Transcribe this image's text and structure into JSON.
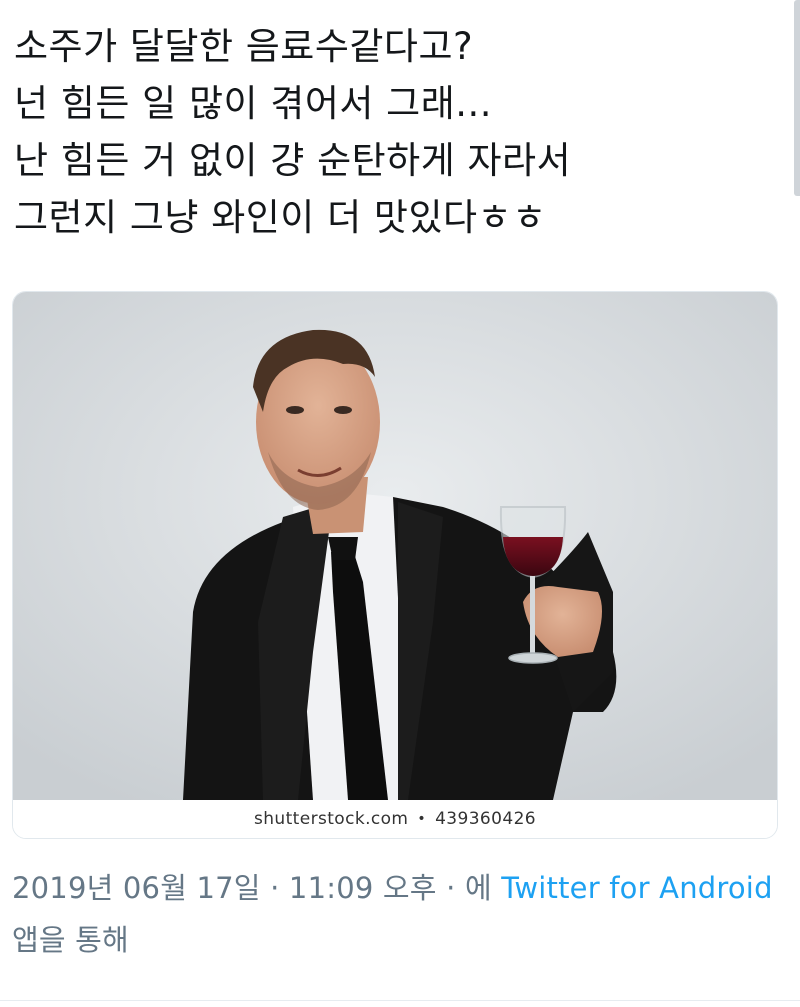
{
  "tweet": {
    "lines": [
      "소주가 달달한 음료수같다고?",
      "넌 힘든 일 많이 겪어서 그래...",
      "난 힘든 거 없이 걍 순탄하게 자라서",
      "그런지 그냥 와인이 더 맛있다ㅎㅎ"
    ]
  },
  "media": {
    "watermark_site": "shutterstock.com",
    "watermark_separator": "•",
    "watermark_id": "439360426"
  },
  "meta": {
    "timestamp": "2019년 06월 17일 · 11:09 오후 · 에",
    "source_link": "Twitter for Android",
    "source_suffix": "앱을 통해"
  },
  "colors": {
    "link": "#1da1f2",
    "meta_gray": "#657786",
    "text": "#14171a"
  }
}
